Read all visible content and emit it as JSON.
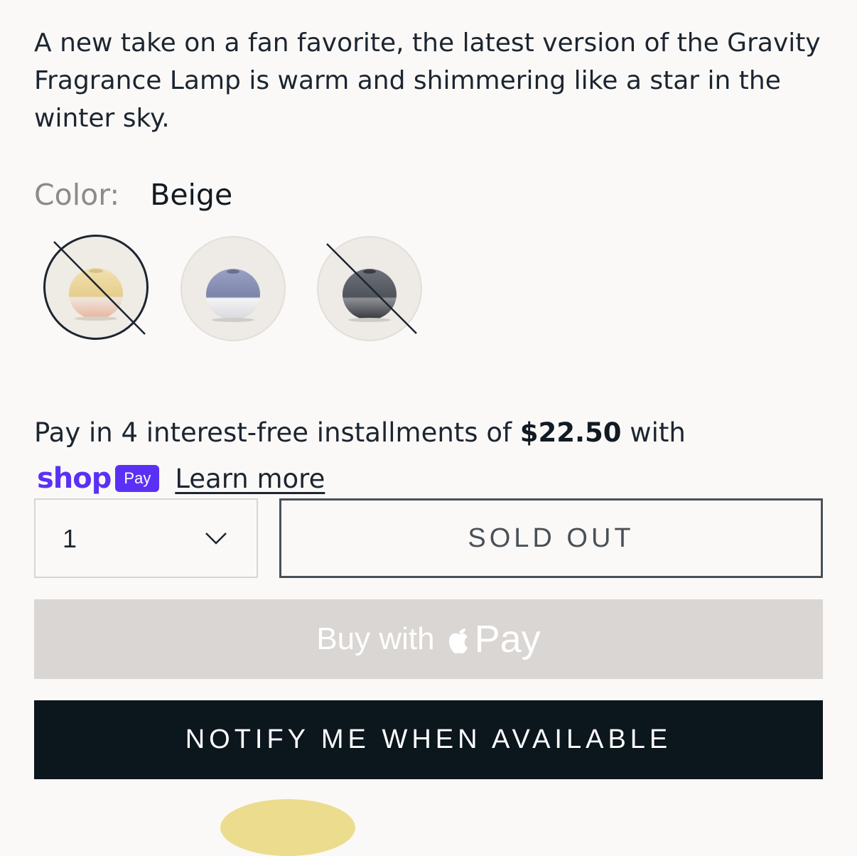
{
  "product": {
    "description": "A new take on a fan favorite, the latest version of the Gravity Fragrance Lamp is warm and shimmering like a star in the winter sky."
  },
  "color": {
    "label": "Color:",
    "selected": "Beige",
    "swatches": [
      {
        "name": "Beige",
        "available": false,
        "selected": true,
        "top_color": "#e8d39a",
        "bottom_color": "#e3b6a0"
      },
      {
        "name": "Blue",
        "available": true,
        "selected": false,
        "top_color": "#8d95b6",
        "bottom_color": "#dfe0e4"
      },
      {
        "name": "Grey",
        "available": false,
        "selected": false,
        "top_color": "#5b5f66",
        "bottom_color": "#3c3d41"
      }
    ]
  },
  "installments": {
    "prefix": "Pay in 4 interest-free installments of ",
    "amount": "$22.50",
    "suffix": " with",
    "shop_logo": "shop",
    "pay_badge": "Pay",
    "learn_more": "Learn more"
  },
  "quantity": {
    "value": "1",
    "icon": "chevron-down-icon"
  },
  "buttons": {
    "sold_out": "SOLD OUT",
    "buy_with": "Buy with",
    "apple_pay": "Pay",
    "notify": "NOTIFY ME WHEN AVAILABLE"
  },
  "colors": {
    "shop_purple": "#5a31f4",
    "notify_bg": "#0c161d",
    "apple_pay_bg": "#d9d6d3"
  }
}
